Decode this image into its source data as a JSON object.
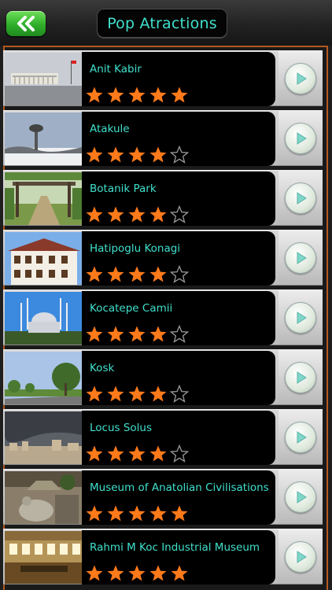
{
  "header": {
    "title": "Pop Atractions",
    "back_icon": "double-chevron-left-icon"
  },
  "colors": {
    "accent_text": "#40e0cc",
    "star_fill": "#ff7a1a",
    "back_button": "#3dbb35",
    "frame_border": "#b3581f"
  },
  "attractions": [
    {
      "name": "Anit Kabir",
      "rating": 5
    },
    {
      "name": "Atakule",
      "rating": 4
    },
    {
      "name": "Botanik Park",
      "rating": 4
    },
    {
      "name": "Hatipoglu Konagi",
      "rating": 4
    },
    {
      "name": "Kocatepe Camii",
      "rating": 4
    },
    {
      "name": "Kosk",
      "rating": 4
    },
    {
      "name": "Locus Solus",
      "rating": 4
    },
    {
      "name": "Museum of Anatolian Civilisations",
      "rating": 5
    },
    {
      "name": "Rahmi M Koc Industrial Museum",
      "rating": 5
    }
  ],
  "rating_max": 5
}
